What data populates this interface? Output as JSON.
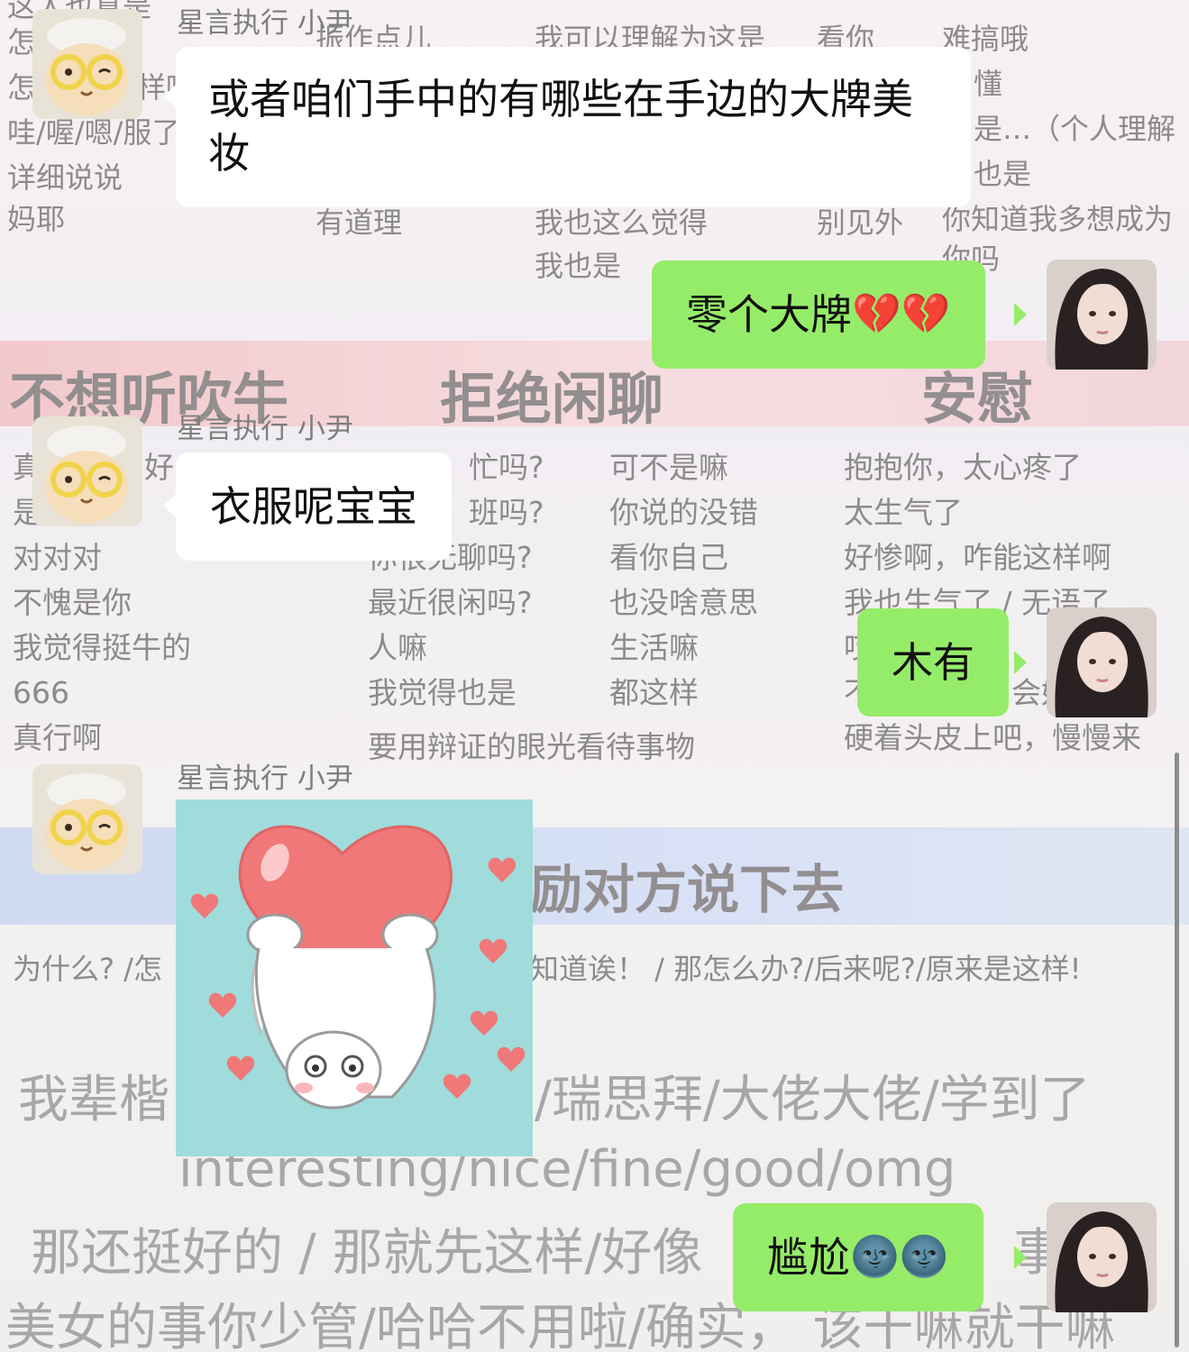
{
  "wallpaper": {
    "top_texts": [
      "这人也真是",
      "怎",
      "怎",
      "详细说说",
      "妈耶",
      "振作点儿",
      "有道理",
      "我可以理解为这是",
      "我也这么觉得",
      "我也是",
      "看你",
      "别见外",
      "难搞哦",
      "懂",
      "是…（个人理解",
      "也是",
      "你知道我多想成为",
      "你吗",
      "哇/喔/嗯/服了",
      "样呢"
    ],
    "headings": [
      "不想听吹牛",
      "拒绝闲聊",
      "安慰"
    ],
    "col1": [
      "真",
      "是",
      "对对对",
      "不愧是你",
      "我觉得挺牛的",
      "666",
      "真行啊"
    ],
    "col1_frag": "好",
    "col2": [
      "忙吗?",
      "班吗?",
      "你很无聊吗?",
      "最近很闲吗?",
      "人嘛",
      "我觉得也是",
      "要用辩证的眼光看待事物"
    ],
    "col3": [
      "可不是嘛",
      "你说的没错",
      "看你自己",
      "也没啥意思",
      "生活嘛",
      "都这样"
    ],
    "col4": [
      "抱抱你，太心疼了",
      "太生气了",
      "好惨啊，咋能这样啊",
      "我也生气了 / 无语了",
      "哎",
      "不",
      "硬着头皮上吧，慢慢来"
    ],
    "col4_frag": "会好的",
    "blue_heading": "励对方说下去",
    "line_why": "为什么? /怎",
    "line_after": "知道诶！ / 那怎么办?/后来呢?/原来是这样!",
    "big1_left": "我辈楷",
    "big1_right": "/瑞思拜/大佬大佬/学到了",
    "big2": "interesting/nice/fine/good/omg",
    "big3": "那还挺好的 / 那就先这样/好像",
    "big3_frag": "事",
    "big4": "美女的事你少管/哈哈不用啦/确实，  该干嘛就干嘛"
  },
  "chat": {
    "messages": [
      {
        "side": "left",
        "sender": "星言执行 小尹",
        "type": "text",
        "text": "或者咱们手中的有哪些在手边的大牌美妆"
      },
      {
        "side": "right",
        "type": "text",
        "text": "零个大牌",
        "emoji": "💔💔"
      },
      {
        "side": "left",
        "sender": "星言执行 小尹",
        "type": "text",
        "text": "衣服呢宝宝"
      },
      {
        "side": "right",
        "type": "text",
        "text": "木有"
      },
      {
        "side": "left",
        "sender": "星言执行 小尹",
        "type": "sticker",
        "sticker": "cat-holding-heart-sticker"
      },
      {
        "side": "right",
        "type": "text",
        "text": "尴尬",
        "emoji": "🌚🌚"
      }
    ]
  },
  "colors": {
    "bubble_green": "#95ec69",
    "bubble_white": "#ffffff",
    "sender_gray": "#7e7e7e",
    "sticker_bg": "#9fdcdb",
    "heart_red": "#f07878"
  }
}
